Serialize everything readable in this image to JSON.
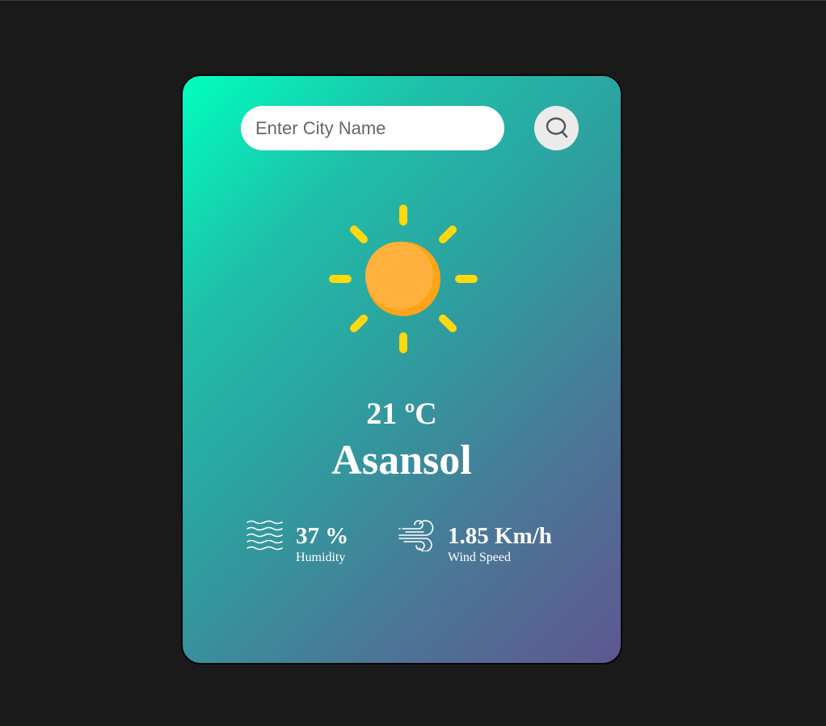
{
  "search": {
    "placeholder": "Enter City Name",
    "value": ""
  },
  "weather": {
    "icon": "sun-icon",
    "temperature": "21 ºC",
    "city": "Asansol"
  },
  "humidity": {
    "value": "37 %",
    "label": "Humidity",
    "icon": "humidity-icon"
  },
  "wind": {
    "value": "1.85 Km/h",
    "label": "Wind Speed",
    "icon": "wind-icon"
  },
  "colors": {
    "background": "#1a1a1a",
    "gradient_start": "#00ffbf",
    "gradient_end": "#5e5791",
    "sun_core": "#ffb13b",
    "sun_rays": "#ffd80d"
  }
}
